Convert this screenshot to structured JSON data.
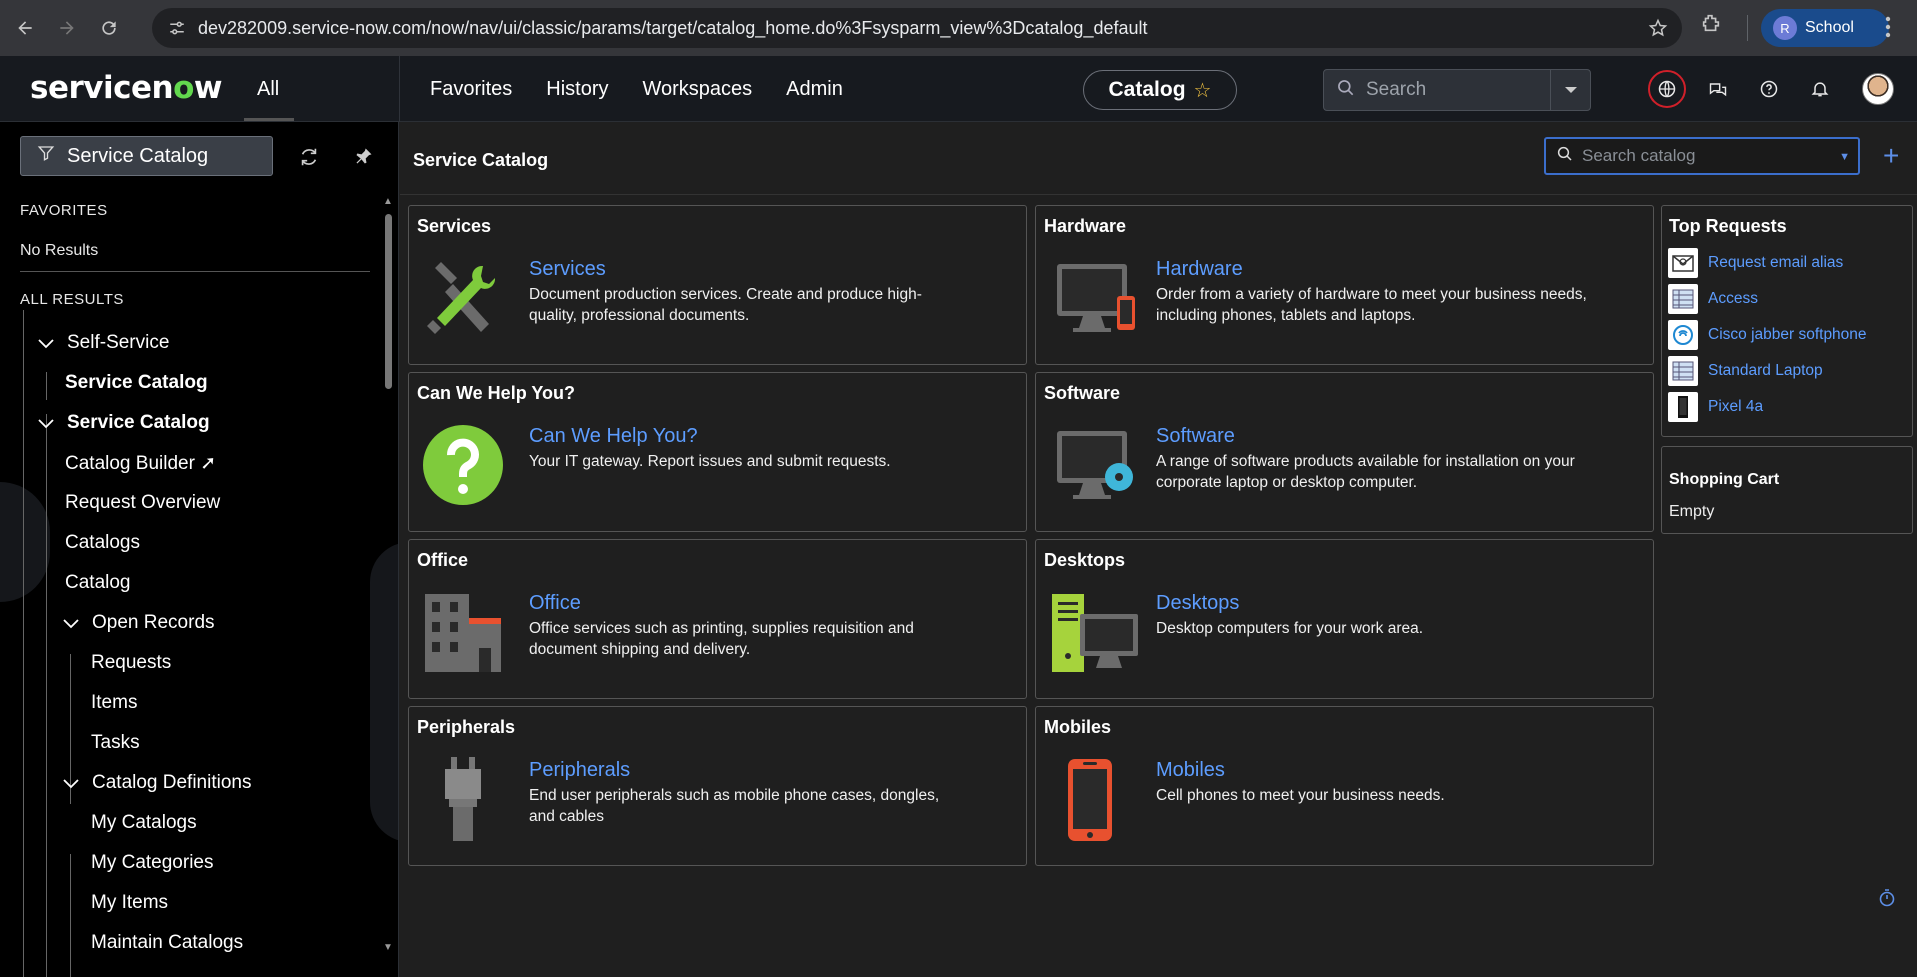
{
  "browser": {
    "url": "dev282009.service-now.com/now/nav/ui/classic/params/target/catalog_home.do%3Fsysparm_view%3Dcatalog_default",
    "profile_initial": "R",
    "profile_label": "School"
  },
  "header": {
    "logo_pre": "servicen",
    "logo_o": "o",
    "logo_post": "w",
    "all": "All",
    "nav": [
      "Favorites",
      "History",
      "Workspaces",
      "Admin"
    ],
    "catalog_pill": "Catalog",
    "search_placeholder": "Search"
  },
  "sidebar": {
    "filter_value": "Service Catalog",
    "favorites_heading": "FAVORITES",
    "no_results": "No Results",
    "all_results_heading": "ALL RESULTS",
    "items": [
      {
        "label": "Self-Service"
      },
      {
        "label": "Service Catalog"
      },
      {
        "label": "Service Catalog"
      },
      {
        "label": "Catalog Builder ➚"
      },
      {
        "label": "Request Overview"
      },
      {
        "label": "Catalogs"
      },
      {
        "label": "Catalog"
      },
      {
        "label": "Open Records"
      },
      {
        "label": "Requests"
      },
      {
        "label": "Items"
      },
      {
        "label": "Tasks"
      },
      {
        "label": "Catalog Definitions"
      },
      {
        "label": "My Catalogs"
      },
      {
        "label": "My Categories"
      },
      {
        "label": "My Items"
      },
      {
        "label": "Maintain Catalogs"
      }
    ]
  },
  "main": {
    "title": "Service Catalog",
    "search_placeholder": "Search catalog",
    "cards": [
      {
        "title": "Services",
        "link": "Services",
        "desc": "Document production services. Create and produce high-quality, professional documents.",
        "icon": "tools-icon"
      },
      {
        "title": "Hardware",
        "link": "Hardware",
        "desc": "Order from a variety of hardware to meet your business needs, including phones, tablets and laptops.",
        "icon": "hardware-icon"
      },
      {
        "title": "Can We Help You?",
        "link": "Can We Help You?",
        "desc": "Your IT gateway. Report issues and submit requests.",
        "icon": "question-icon"
      },
      {
        "title": "Software",
        "link": "Software",
        "desc": "A range of software products available for installation on your corporate laptop or desktop computer.",
        "icon": "software-icon"
      },
      {
        "title": "Office",
        "link": "Office",
        "desc": "Office services such as printing, supplies requisition and document shipping and delivery.",
        "icon": "office-building-icon"
      },
      {
        "title": "Desktops",
        "link": "Desktops",
        "desc": "Desktop computers for your work area.",
        "icon": "desktop-icon"
      },
      {
        "title": "Peripherals",
        "link": "Peripherals",
        "desc": "End user peripherals such as mobile phone cases, dongles, and cables",
        "icon": "cable-plug-icon"
      },
      {
        "title": "Mobiles",
        "link": "Mobiles",
        "desc": "Cell phones to meet your business needs.",
        "icon": "mobile-phone-icon"
      }
    ],
    "top_requests": {
      "title": "Top Requests",
      "items": [
        "Request email alias",
        "Access",
        "Cisco jabber softphone",
        "Standard Laptop",
        "Pixel 4a"
      ]
    },
    "cart": {
      "title": "Shopping Cart",
      "status": "Empty"
    }
  }
}
